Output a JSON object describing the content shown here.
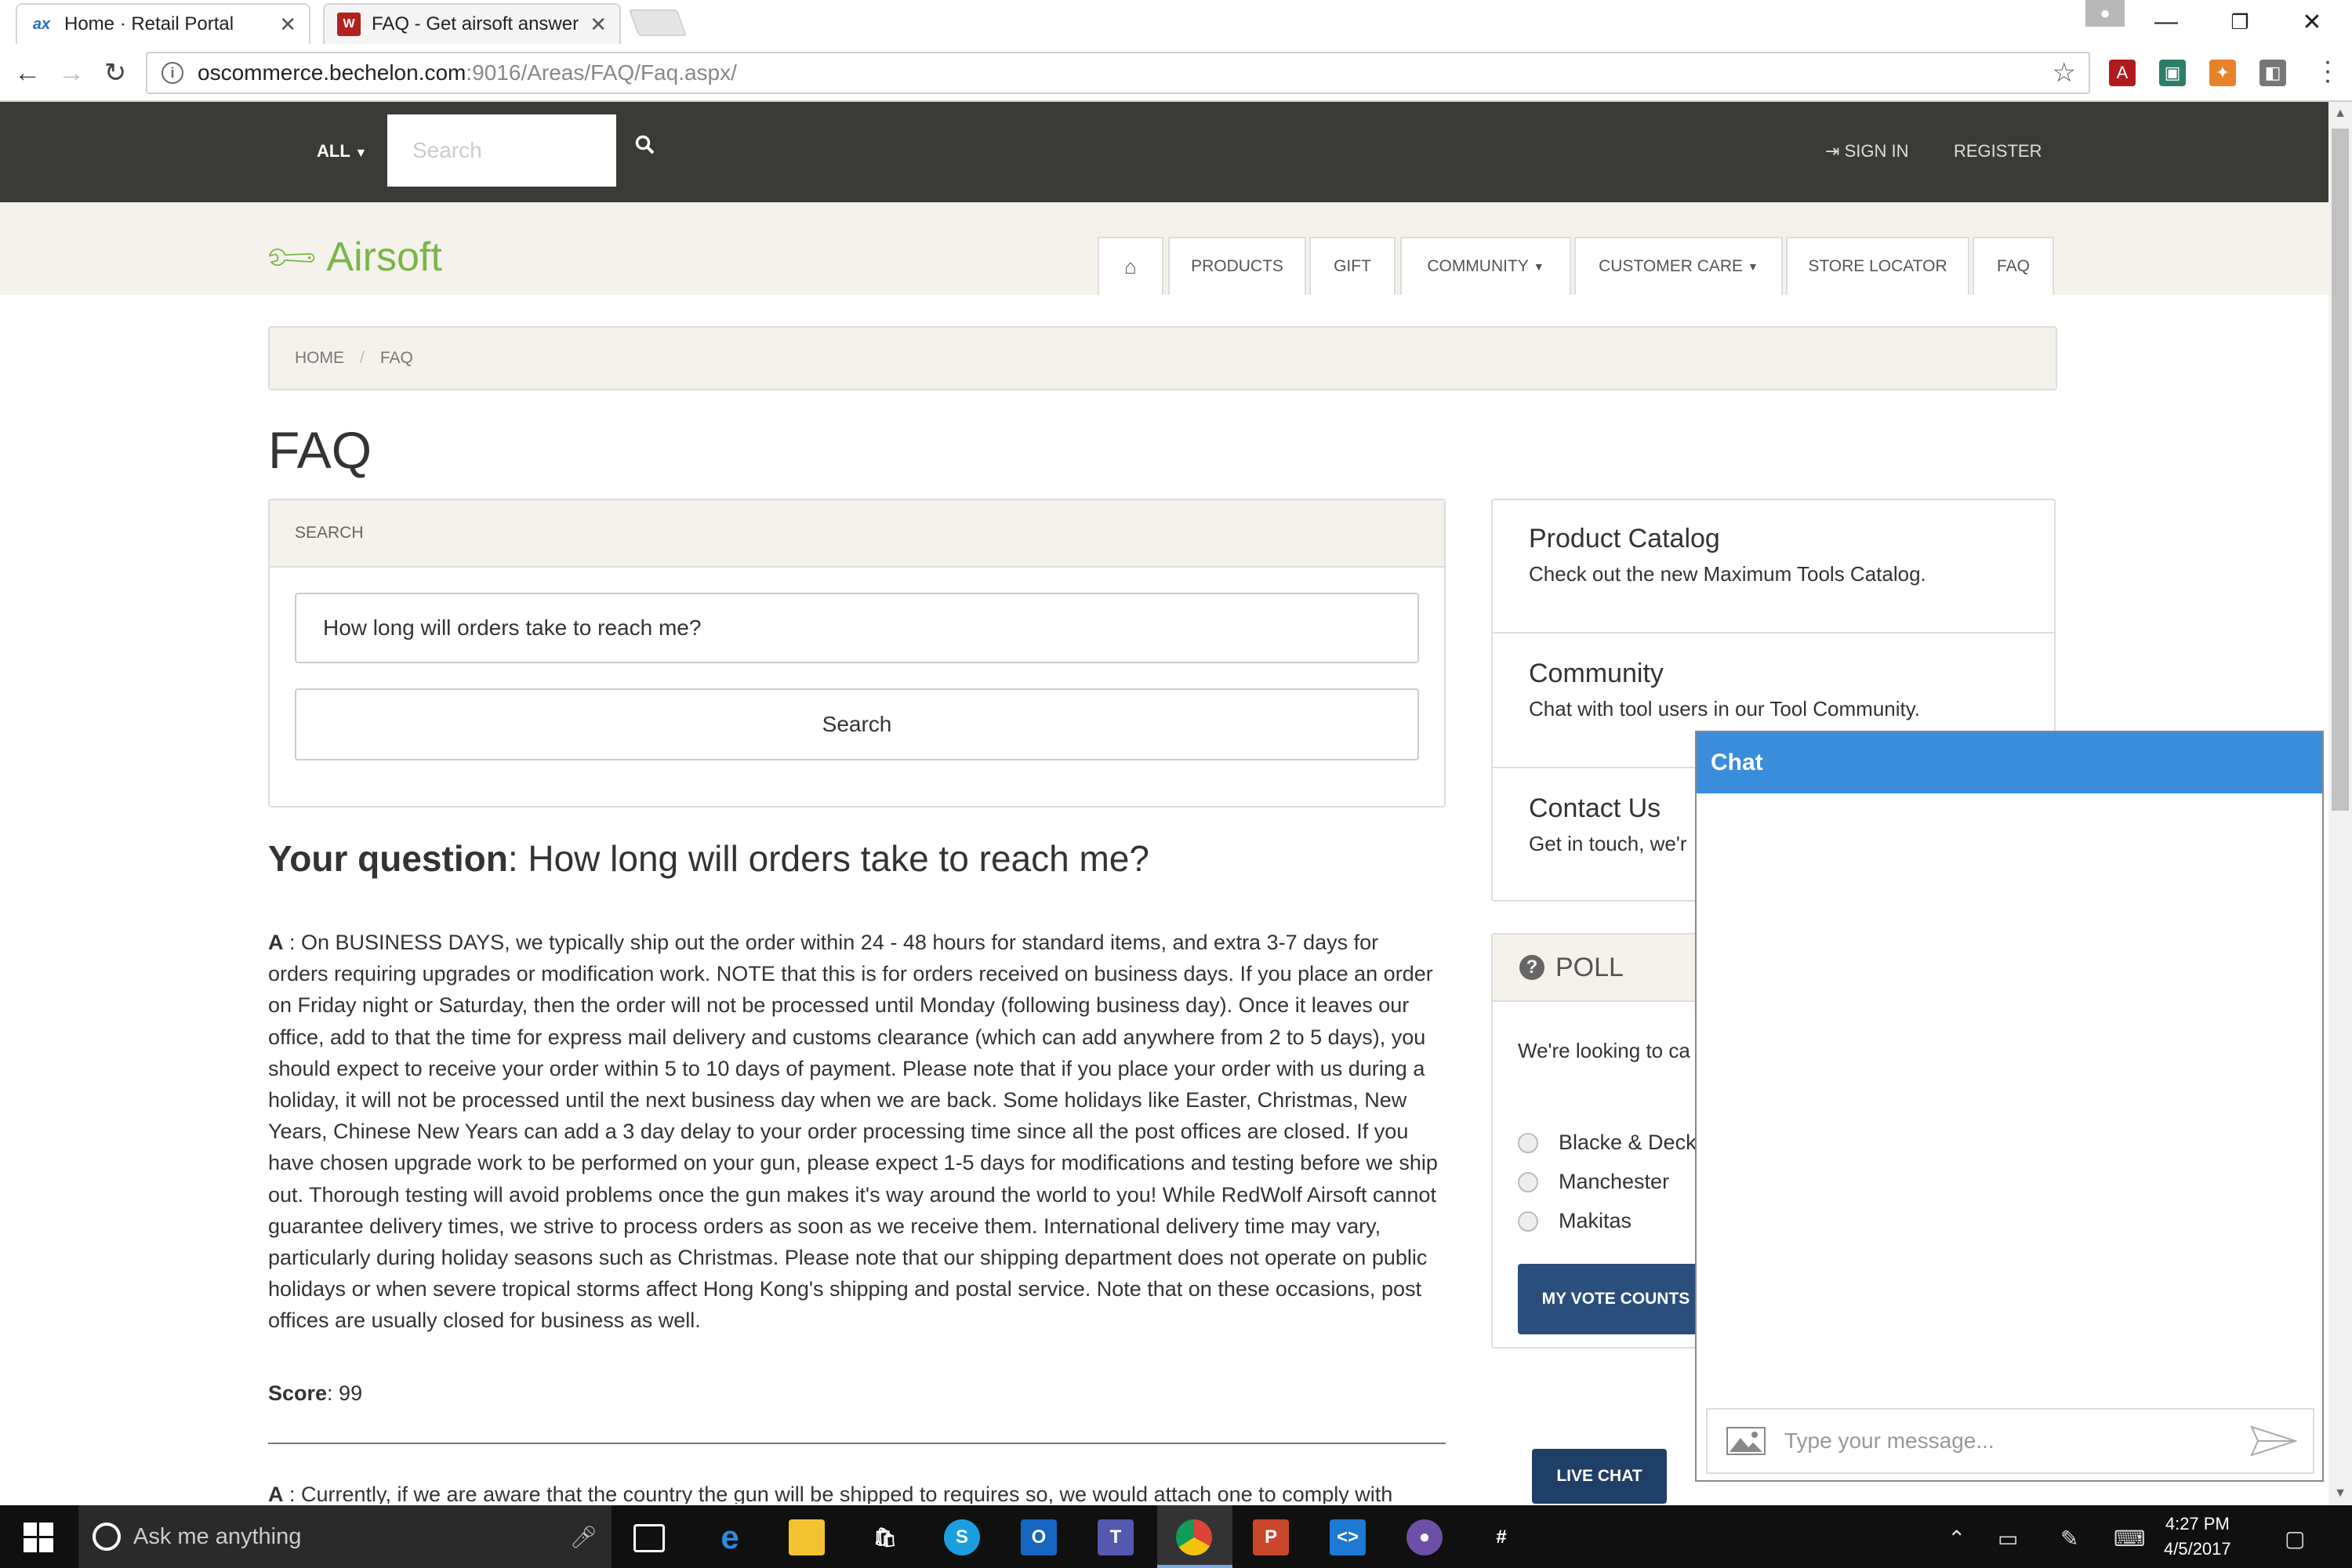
{
  "browser": {
    "tabs": [
      {
        "title": "Home · Retail Portal",
        "favicon": "ax-logo-icon"
      },
      {
        "title": "FAQ - Get airsoft answer",
        "favicon": "redwolf-icon"
      }
    ],
    "url_host": "oscommerce.bechelon.com",
    "url_path": ":9016/Areas/FAQ/Faq.aspx/"
  },
  "topnav": {
    "category_dropdown": "ALL",
    "search_placeholder": "Search",
    "sign_in": "SIGN IN",
    "register": "REGISTER"
  },
  "brand": {
    "name": "Airsoft",
    "color": "#7ab648"
  },
  "menu": [
    "PRODUCTS",
    "GIFT",
    "COMMUNITY",
    "CUSTOMER CARE",
    "STORE LOCATOR",
    "FAQ"
  ],
  "breadcrumb": [
    "HOME",
    "FAQ"
  ],
  "page_title": "FAQ",
  "search_panel": {
    "heading": "SEARCH",
    "query": "How long will orders take to reach me?",
    "button": "Search"
  },
  "question": {
    "label": "Your question",
    "text": ": How long will orders take to reach me?"
  },
  "answers": [
    {
      "prefix": "A",
      "text": " : On BUSINESS DAYS, we typically ship out the order within 24 - 48 hours for standard items, and extra 3-7 days for orders requiring upgrades or modification work. NOTE that this is for orders received on business days. If you place an order on Friday night or Saturday, then the order will not be processed until Monday (following business day). Once it leaves our office, add to that the time for express mail delivery and customs clearance (which can add anywhere from 2 to 5 days), you should expect to receive your order within 5 to 10 days of payment. Please note that if you place your order with us during a holiday, it will not be processed until the next business day when we are back. Some holidays like Easter, Christmas, New Years, Chinese New Years can add a 3 day delay to your order processing time since all the post offices are closed. If you have chosen upgrade work to be performed on your gun, please expect 1-5 days for modifications and testing before we ship out. Thorough testing will avoid problems once the gun makes it's way around the world to you! While RedWolf Airsoft cannot guarantee delivery times, we strive to process orders as soon as we receive them. International delivery time may vary, particularly during holiday seasons such as Christmas. Please note that our shipping department does not operate on public holidays or when severe tropical storms affect Hong Kong's shipping and postal service. Note that on these occasions, post offices are usually closed for business as well.",
      "score_label": "Score",
      "score": ": 99"
    },
    {
      "prefix": "A",
      "text": " : Currently, if we are aware that the country the gun will be shipped to requires so, we would attach one to comply with"
    }
  ],
  "sidebar": {
    "items": [
      {
        "title": "Product Catalog",
        "text": "Check out the new Maximum Tools Catalog."
      },
      {
        "title": "Community",
        "text": "Chat with tool users in our Tool Community."
      },
      {
        "title": "Contact Us",
        "text": "Get in touch, we'r"
      }
    ],
    "poll": {
      "title": "POLL",
      "question": "We're looking to ca powered electric d best. Tell us which",
      "options": [
        "Blacke & Decka",
        "Manchester",
        "Makitas"
      ],
      "vote_button": "MY VOTE COUNTS"
    },
    "live_chat": "LIVE CHAT"
  },
  "chat": {
    "title": "Chat",
    "placeholder": "Type your message...",
    "header_color": "#3a8ddb"
  },
  "taskbar": {
    "search_placeholder": "Ask me anything",
    "time": "4:27 PM",
    "date": "4/5/2017"
  }
}
